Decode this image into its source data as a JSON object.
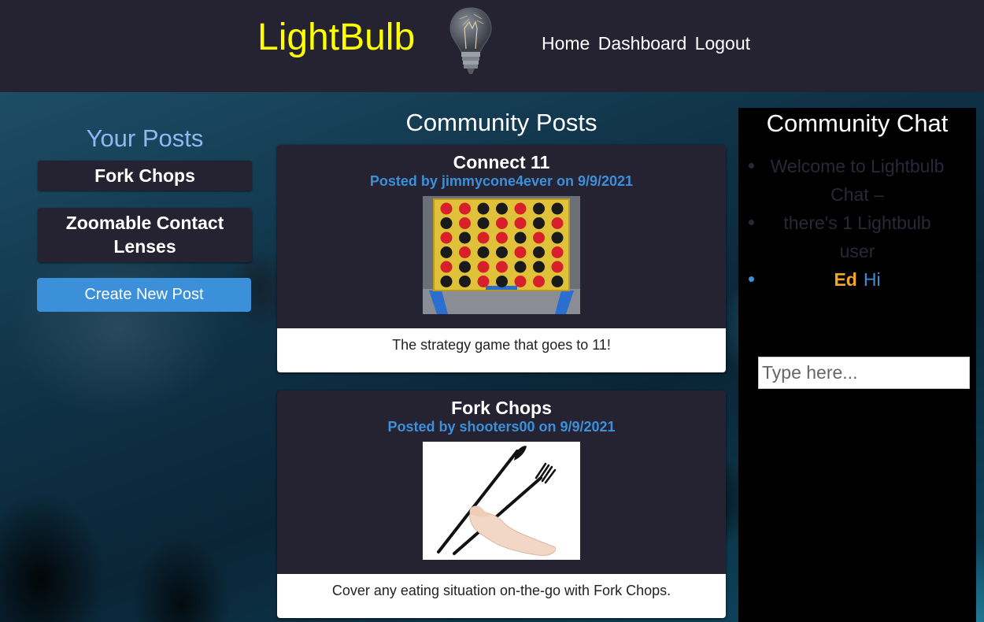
{
  "header": {
    "logo_text": "LightBulb",
    "nav": [
      "Home",
      "Dashboard",
      "Logout"
    ]
  },
  "your_posts": {
    "title": "Your Posts",
    "items": [
      "Fork Chops",
      "Zoomable Contact Lenses"
    ],
    "create_button": "Create New Post"
  },
  "community_posts": {
    "title": "Community Posts",
    "posts": [
      {
        "title": "Connect 11",
        "meta": "Posted by jimmycone4ever on 9/9/2021",
        "body": "The strategy game that goes to 11!"
      },
      {
        "title": "Fork Chops",
        "meta": "Posted by shooters00 on 9/9/2021",
        "body": "Cover any eating situation on-the-go with Fork Chops."
      }
    ]
  },
  "chat": {
    "title": "Community Chat",
    "system_messages": [
      "Welcome to Lightbulb Chat –",
      "there's 1 Lightbulb user"
    ],
    "messages": [
      {
        "user": "Ed",
        "text": "Hi"
      }
    ],
    "input_placeholder": "Type here..."
  },
  "colors": {
    "header_bg": "#252232",
    "logo": "#ffff00",
    "accent": "#3c8fd9",
    "chat_user": "#f5a623"
  }
}
